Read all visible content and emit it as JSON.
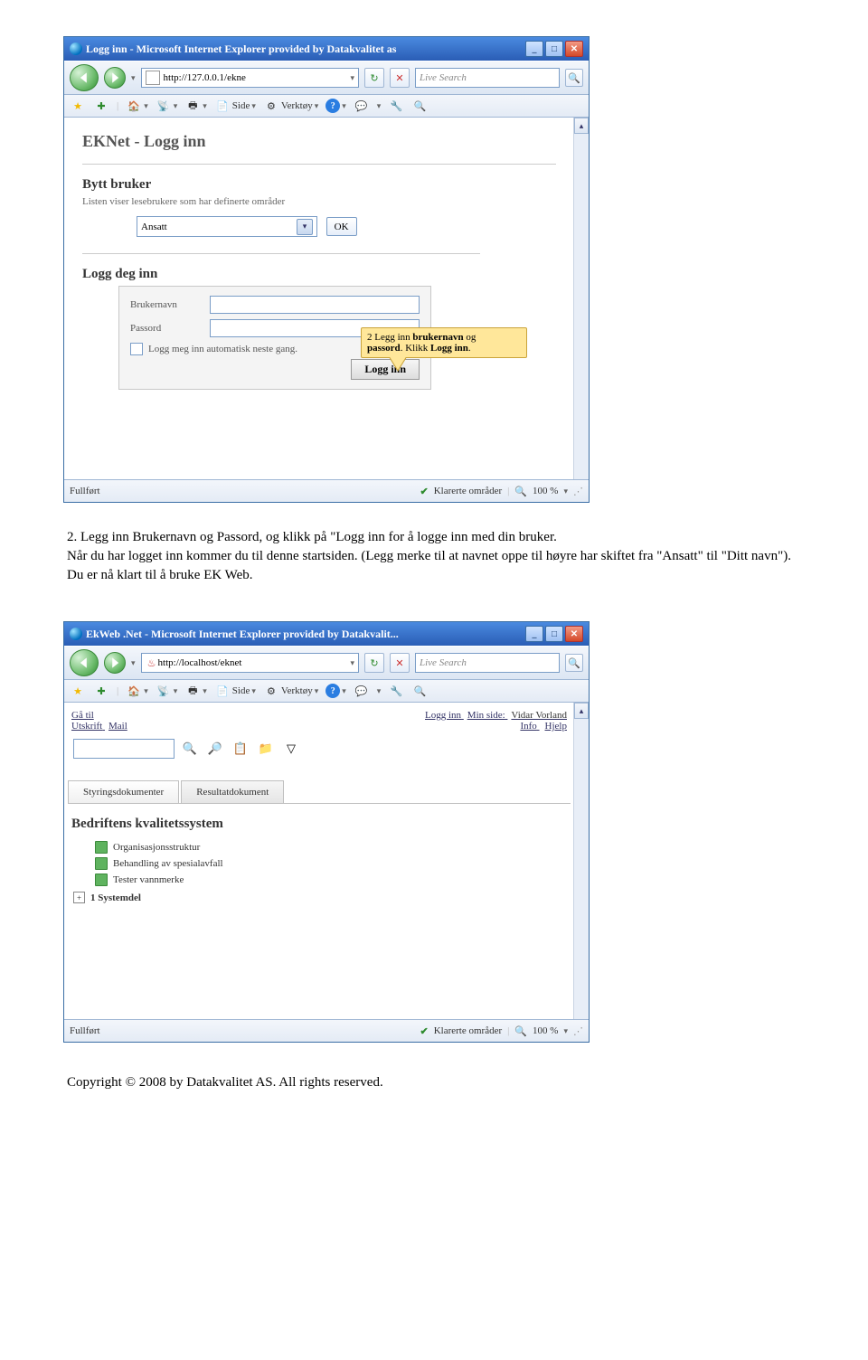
{
  "window1": {
    "title": "Logg inn - Microsoft Internet Explorer provided by Datakvalitet as",
    "url": "http://127.0.0.1/ekne",
    "search_placeholder": "Live Search",
    "toolbar": {
      "side": "Side",
      "verktoy": "Verktøy"
    },
    "app": {
      "heading": "EKNet - Logg inn",
      "bytt_heading": "Bytt bruker",
      "bytt_sub": "Listen viser lesebrukere som har definerte områder",
      "select_value": "Ansatt",
      "ok": "OK",
      "logg_heading": "Logg deg inn",
      "username_label": "Brukernavn",
      "password_label": "Passord",
      "remember_label": "Logg meg inn automatisk neste gang.",
      "login_btn": "Logg inn",
      "callout_line1": "2 Legg inn ",
      "callout_bold1": "brukernavn",
      "callout_line1b": " og ",
      "callout_bold2": "passord",
      "callout_line2a": ". Klikk ",
      "callout_bold3": "Logg inn",
      "callout_line2b": "."
    },
    "status": {
      "left": "Fullført",
      "trusted": "Klarerte områder",
      "zoom": "100 %"
    }
  },
  "doc_text": "2. Legg inn Brukernavn og Passord, og klikk på \"Logg inn for å logge inn med din bruker.\n Når du har logget inn kommer du til denne startsiden. (Legg merke til at navnet oppe til høyre har skiftet fra \"Ansatt\" til \"Ditt navn\"). Du er nå klart til å bruke EK Web.",
  "window2": {
    "title": "EkWeb .Net - Microsoft Internet Explorer provided by Datakvalit...",
    "url": "http://localhost/eknet",
    "search_placeholder": "Live Search",
    "toolbar": {
      "side": "Side",
      "verktoy": "Verktøy"
    },
    "app": {
      "nav_left": [
        "Gå til",
        "Utskrift",
        "Mail"
      ],
      "nav_right_links": [
        "Logg inn",
        "Min side:"
      ],
      "user_name": "Vidar Vorland",
      "nav_right2": [
        "Info",
        "Hjelp"
      ],
      "tabs": [
        "Styringsdokumenter",
        "Resultatdokument"
      ],
      "heading": "Bedriftens kvalitetssystem",
      "tree": [
        "Organisasjonsstruktur",
        "Behandling av spesialavfall",
        "Tester vannmerke"
      ],
      "branch": "1 Systemdel"
    },
    "status": {
      "left": "Fullført",
      "trusted": "Klarerte områder",
      "zoom": "100 %"
    }
  },
  "footer": "Copyright © 2008 by Datakvalitet AS. All rights reserved."
}
